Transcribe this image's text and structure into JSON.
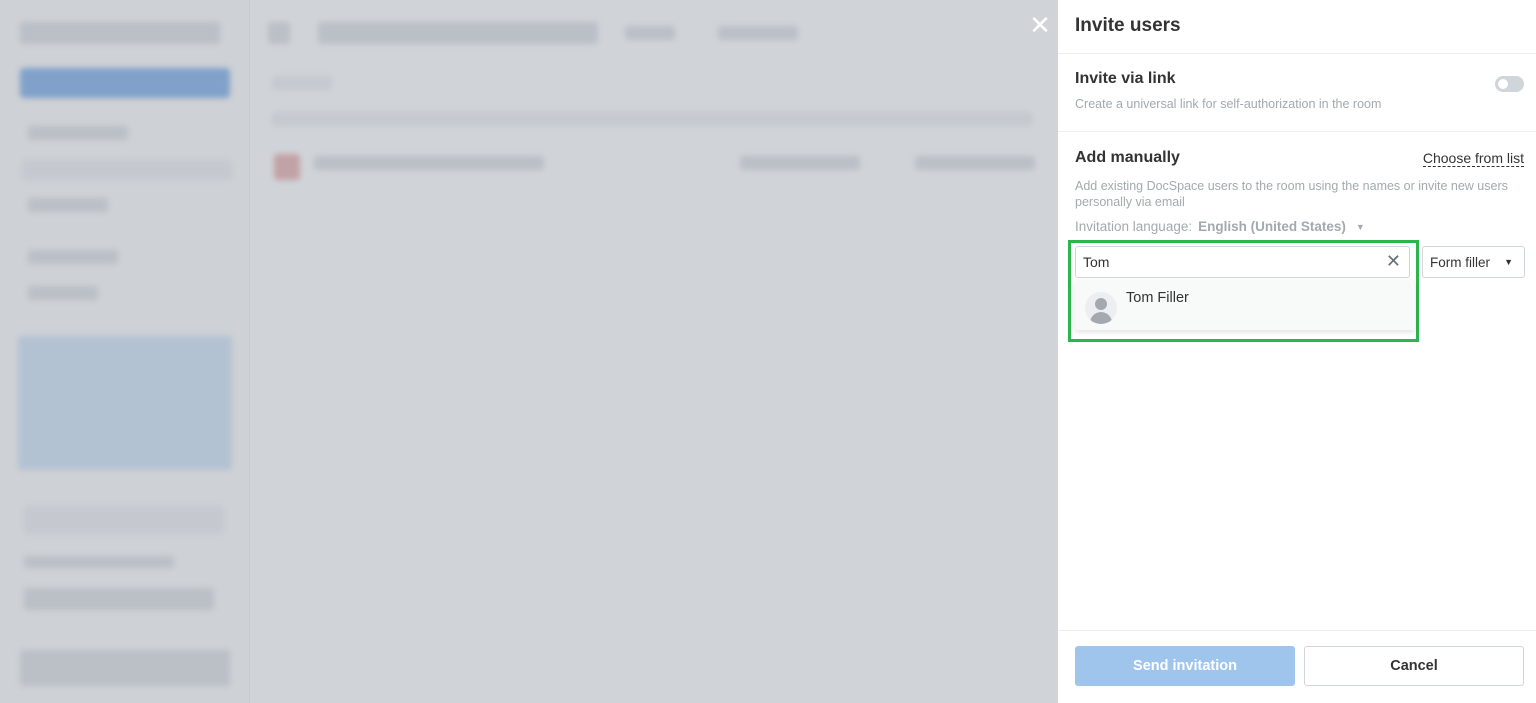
{
  "panel": {
    "title": "Invite users",
    "close_icon": "close-icon"
  },
  "invite_link": {
    "title": "Invite via link",
    "description": "Create a universal link for self-authorization in the room",
    "enabled": false
  },
  "manual": {
    "title": "Add manually",
    "choose_from_list": "Choose from list",
    "description": "Add existing DocSpace users to the room using the names or invite new users personally via email",
    "language_label": "Invitation language:",
    "language_value": "English (United States)",
    "search_value": "Tom",
    "role": "Form filler"
  },
  "results": [
    {
      "name": "Tom Filler"
    }
  ],
  "footer": {
    "send_label": "Send invitation",
    "cancel_label": "Cancel"
  },
  "colors": {
    "highlight": "#2db54d",
    "send_button": "#9fc5ed"
  }
}
